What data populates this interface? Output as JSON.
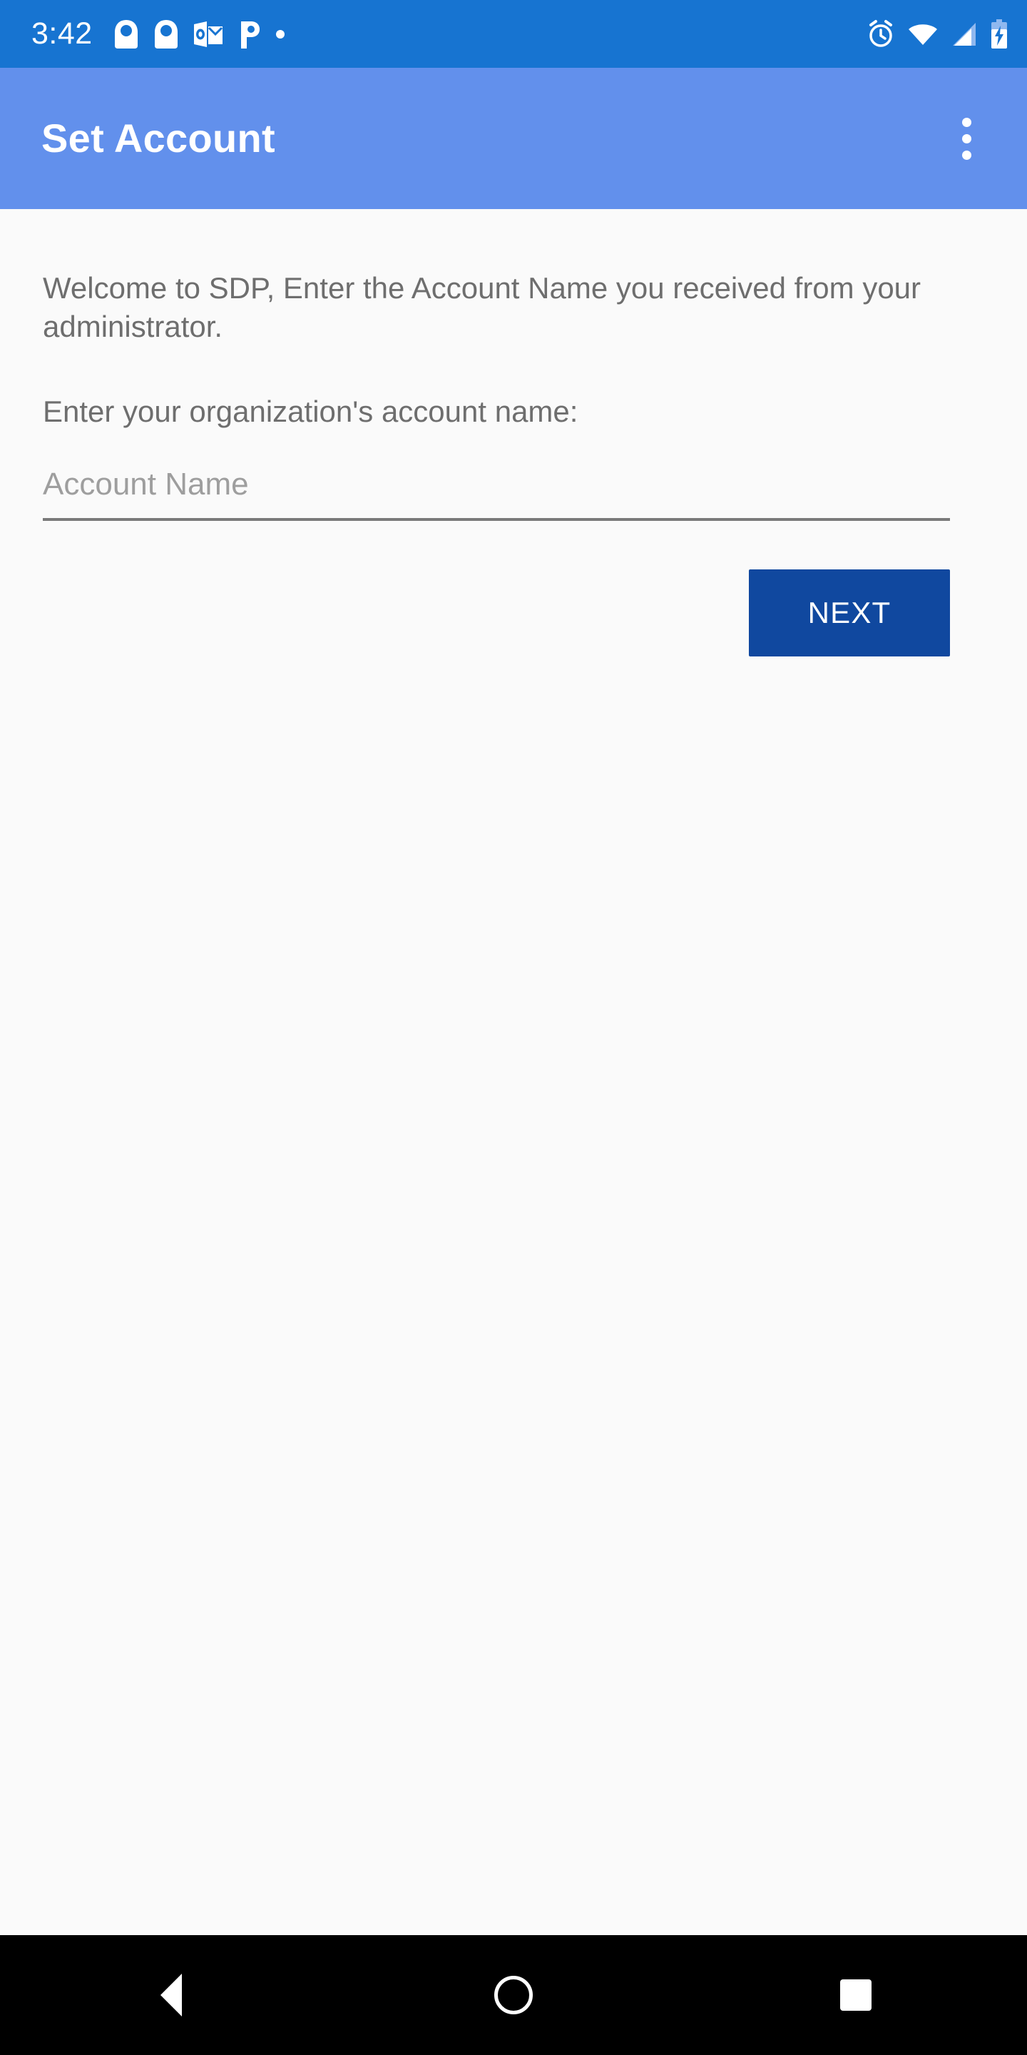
{
  "status_bar": {
    "time": "3:42",
    "background_color": "#1774d1",
    "left_icons": [
      {
        "name": "app-badge-icon-1",
        "glyph": "badge"
      },
      {
        "name": "app-badge-icon-2",
        "glyph": "badge"
      },
      {
        "name": "outlook-icon",
        "glyph": "outlook"
      },
      {
        "name": "p-app-icon",
        "glyph": "P"
      },
      {
        "name": "notification-dot-icon",
        "glyph": "dot"
      }
    ],
    "right_icons": [
      {
        "name": "alarm-icon",
        "glyph": "alarm"
      },
      {
        "name": "wifi-icon",
        "glyph": "wifi"
      },
      {
        "name": "cellular-signal-icon",
        "glyph": "signal"
      },
      {
        "name": "battery-charging-icon",
        "glyph": "battery"
      }
    ]
  },
  "app_bar": {
    "title": "Set Account",
    "background_color": "#6290ec",
    "title_color": "#ffffff",
    "overflow_menu_label": "More options"
  },
  "main": {
    "welcome_text": "Welcome to SDP, Enter the Account Name you received from your administrator.",
    "prompt_text": "Enter your organization's account name:",
    "account_field": {
      "placeholder": "Account Name",
      "value": ""
    },
    "next_button": {
      "label": "NEXT",
      "background_color": "#10489f",
      "text_color": "#ffffff"
    },
    "background_color": "#fafafa",
    "body_text_color": "#6e6e6e"
  },
  "nav_bar": {
    "background_color": "#000000",
    "buttons": [
      {
        "name": "back-button",
        "label": "Back"
      },
      {
        "name": "home-button",
        "label": "Home"
      },
      {
        "name": "recents-button",
        "label": "Recents"
      }
    ]
  }
}
